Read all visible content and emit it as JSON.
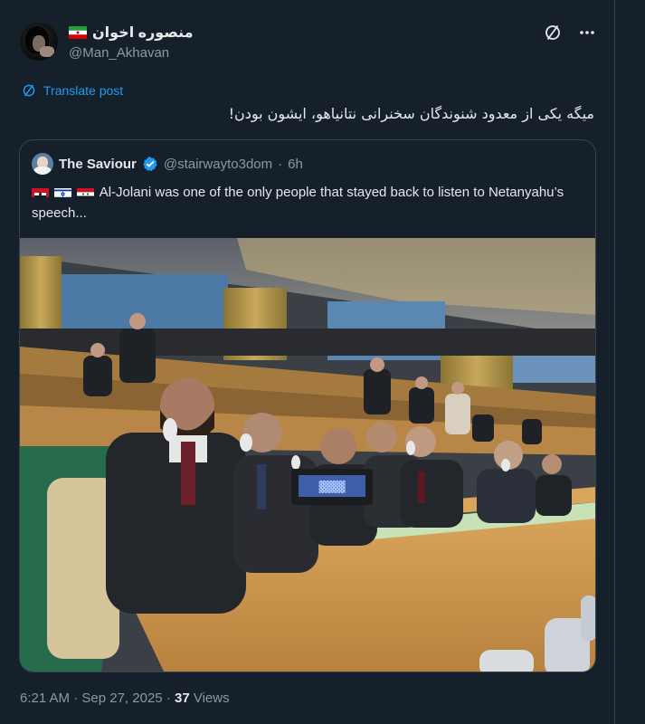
{
  "author": {
    "display_name": "منصوره اخوان",
    "handle": "@Man_Akhavan"
  },
  "translate_label": "Translate post",
  "post_text": "میگه یکی از معدود شنوندگان سخنرانی نتانیاهو، ایشون بودن!",
  "quoted": {
    "name": "The Saviour",
    "handle": "@stairwayto3dom",
    "separator": "·",
    "age": "6h",
    "text": "Al-Jolani was one of the only people that stayed back to listen to Netanyahu’s speech...",
    "flags": [
      "jordan-flag-icon",
      "israel-flag-icon",
      "syria-flag-icon"
    ],
    "image": {
      "screen_text": "▓▓▓▓"
    }
  },
  "meta": {
    "time": "6:21 AM",
    "dot": "·",
    "date": "Sep 27, 2025",
    "views_count": "37",
    "views_label": "Views"
  },
  "colors": {
    "background": "#16202b",
    "link": "#1d9bf0",
    "verified": "#1d9bf0",
    "muted": "#8b98a5",
    "border": "#38444d"
  }
}
